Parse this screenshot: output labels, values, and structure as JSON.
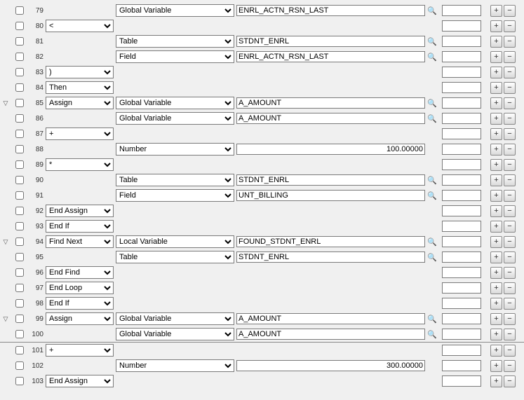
{
  "icons": {
    "plus": "+",
    "minus": "−",
    "search": "🔍",
    "expand": "▽"
  },
  "rows": [
    {
      "n": 79,
      "exp": false,
      "c1": null,
      "c2": "Global Variable",
      "val": "ENRL_ACTN_RSN_LAST",
      "mag": true,
      "num": false
    },
    {
      "n": 80,
      "exp": false,
      "c1": "<",
      "c2": null,
      "val": null,
      "mag": false,
      "num": false
    },
    {
      "n": 81,
      "exp": false,
      "c1": null,
      "c2": "Table",
      "val": "STDNT_ENRL",
      "mag": true,
      "num": false
    },
    {
      "n": 82,
      "exp": false,
      "c1": null,
      "c2": "Field",
      "val": "ENRL_ACTN_RSN_LAST",
      "mag": true,
      "num": false
    },
    {
      "n": 83,
      "exp": false,
      "c1": ")",
      "c2": null,
      "val": null,
      "mag": false,
      "num": false
    },
    {
      "n": 84,
      "exp": false,
      "c1": "Then",
      "c2": null,
      "val": null,
      "mag": false,
      "num": false
    },
    {
      "n": 85,
      "exp": true,
      "c1": "Assign",
      "c2": "Global Variable",
      "val": "A_AMOUNT",
      "mag": true,
      "num": false
    },
    {
      "n": 86,
      "exp": false,
      "c1": null,
      "c2": "Global Variable",
      "val": "A_AMOUNT",
      "mag": true,
      "num": false
    },
    {
      "n": 87,
      "exp": false,
      "c1": "+",
      "c2": null,
      "val": null,
      "mag": false,
      "num": false
    },
    {
      "n": 88,
      "exp": false,
      "c1": null,
      "c2": "Number",
      "val": "100.00000",
      "mag": false,
      "num": true
    },
    {
      "n": 89,
      "exp": false,
      "c1": "*",
      "c2": null,
      "val": null,
      "mag": false,
      "num": false
    },
    {
      "n": 90,
      "exp": false,
      "c1": null,
      "c2": "Table",
      "val": "STDNT_ENRL",
      "mag": true,
      "num": false
    },
    {
      "n": 91,
      "exp": false,
      "c1": null,
      "c2": "Field",
      "val": "UNT_BILLING",
      "mag": true,
      "num": false
    },
    {
      "n": 92,
      "exp": false,
      "c1": "End Assign",
      "c2": null,
      "val": null,
      "mag": false,
      "num": false
    },
    {
      "n": 93,
      "exp": false,
      "c1": "End If",
      "c2": null,
      "val": null,
      "mag": false,
      "num": false
    },
    {
      "n": 94,
      "exp": true,
      "c1": "Find Next",
      "c2": "Local Variable",
      "val": "FOUND_STDNT_ENRL",
      "mag": true,
      "num": false
    },
    {
      "n": 95,
      "exp": false,
      "c1": null,
      "c2": "Table",
      "val": "STDNT_ENRL",
      "mag": true,
      "num": false
    },
    {
      "n": 96,
      "exp": false,
      "c1": "End Find",
      "c2": null,
      "val": null,
      "mag": false,
      "num": false
    },
    {
      "n": 97,
      "exp": false,
      "c1": "End Loop",
      "c2": null,
      "val": null,
      "mag": false,
      "num": false
    },
    {
      "n": 98,
      "exp": false,
      "c1": "End If",
      "c2": null,
      "val": null,
      "mag": false,
      "num": false
    },
    {
      "n": 99,
      "exp": true,
      "c1": "Assign",
      "c2": "Global Variable",
      "val": "A_AMOUNT",
      "mag": true,
      "num": false
    },
    {
      "n": 100,
      "exp": false,
      "c1": null,
      "c2": "Global Variable",
      "val": "A_AMOUNT",
      "mag": true,
      "num": false
    },
    {
      "n": 101,
      "exp": false,
      "c1": "+",
      "c2": null,
      "val": null,
      "mag": false,
      "num": false,
      "sep": true
    },
    {
      "n": 102,
      "exp": false,
      "c1": null,
      "c2": "Number",
      "val": "300.00000",
      "mag": false,
      "num": true
    },
    {
      "n": 103,
      "exp": false,
      "c1": "End Assign",
      "c2": null,
      "val": null,
      "mag": false,
      "num": false
    }
  ]
}
